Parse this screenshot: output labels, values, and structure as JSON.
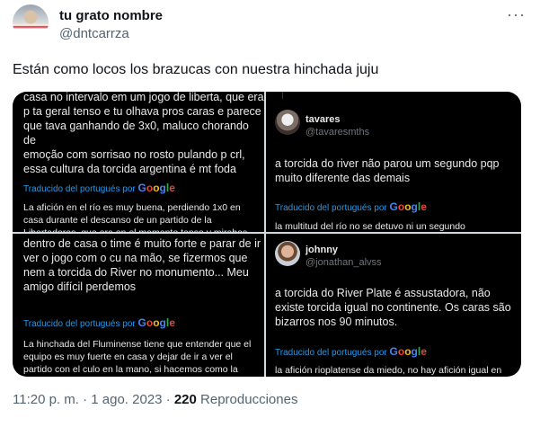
{
  "author": {
    "name": "tu grato nombre",
    "handle": "@dntcarrza"
  },
  "more_label": "···",
  "tweet": {
    "text": "Están como locos los brazucas con nuestra hinchada juju"
  },
  "translated_by": "Traducido del portugués por",
  "google": [
    "G",
    "o",
    "o",
    "g",
    "l",
    "e"
  ],
  "panels": {
    "p1": {
      "text": "casa no intervalo em um jogo de liberta, que era\np ta geral tenso e tu olhava pros caras e parece\nque tava ganhando de 3x0, maluco chorando de\nemoção com sorrisao no rosto pulando p crl,\nessa cultura da torcida argentina é mt foda",
      "translation": "La afición en el río es muy buena, perdiendo 1x0 en\ncasa durante el descanso de un partido de la\nLibertadores, que era en el momento tenso y mirabas"
    },
    "p2": {
      "name": "tavares",
      "handle": "@tavaresmths",
      "text": "a torcida do river não parou um segundo pqp\nmuito diferente das demais",
      "translation": "la multitud del río no se detuvo ni un segundo"
    },
    "p3": {
      "text": "dentro de casa o time é muito forte e parar de ir\nver o jogo com o cu na mão, se fizermos que\nnem a torcida do River no monumento... Meu\namigo difícil perdemos",
      "translation": "La hinchada del Fluminense tiene que entender que el\nequipo es muy fuerte en casa y dejar de ir a ver el\npartido con el culo en la mano, si hacemos como la"
    },
    "p4": {
      "name": "johnny",
      "handle": "@jonathan_alvss",
      "text": "a torcida do River Plate é assustadora, não\nexiste torcida igual no continente. Os caras são\nbizarros nos 90 minutos.",
      "translation": "la afición rioplatense da miedo, no hay afición igual en"
    }
  },
  "footer": {
    "time": "11:20 p. m. · 1 ago. 2023 · ",
    "views_count": "220",
    "views_label": " Reproducciones"
  }
}
